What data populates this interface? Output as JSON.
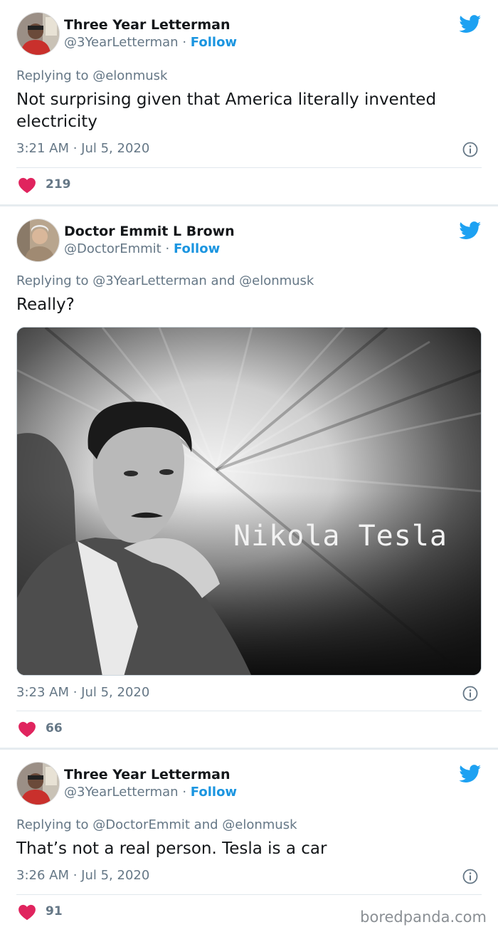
{
  "tweets": [
    {
      "name": "Three Year Letterman",
      "handle": "@3YearLetterman",
      "separator": "·",
      "follow": "Follow",
      "reply_prefix": "Replying to",
      "reply_mentions": "@elonmusk",
      "text": "Not surprising given that America literally invented electricity",
      "timestamp": "3:21 AM · Jul 5, 2020",
      "likes": "219"
    },
    {
      "name": "Doctor Emmit L Brown",
      "handle": "@DoctorEmmit",
      "separator": "·",
      "follow": "Follow",
      "reply_prefix": "Replying to",
      "reply_mentions": "@3YearLetterman and @elonmusk",
      "text": "Really?",
      "media_caption": "Nikola Tesla",
      "timestamp": "3:23 AM · Jul 5, 2020",
      "likes": "66"
    },
    {
      "name": "Three Year Letterman",
      "handle": "@3YearLetterman",
      "separator": "·",
      "follow": "Follow",
      "reply_prefix": "Replying to",
      "reply_mentions": "@DoctorEmmit and @elonmusk",
      "text": "That’s not a real person. Tesla is a car",
      "timestamp": "3:26 AM · Jul 5, 2020",
      "likes": "91"
    }
  ],
  "watermark": "boredpanda.com",
  "colors": {
    "link": "#1b95e0",
    "secondary_text": "#657786",
    "heart": "#e0245e",
    "background": "#e6ecf0"
  },
  "icons": [
    "twitter-bird-icon",
    "info-icon",
    "heart-icon"
  ]
}
